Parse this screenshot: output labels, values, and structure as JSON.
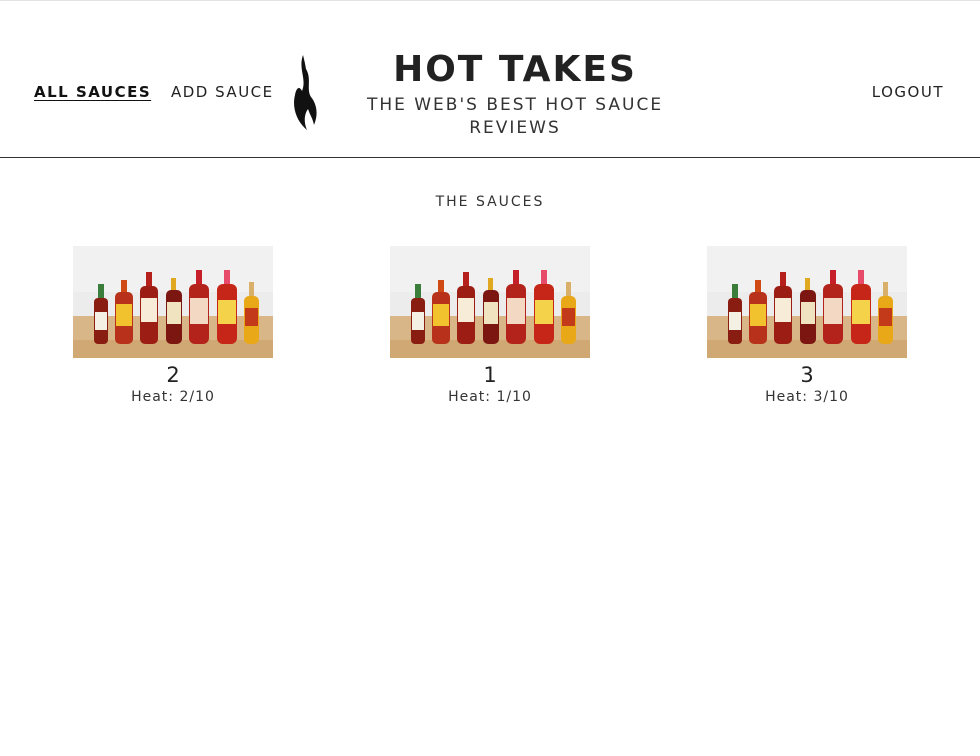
{
  "nav": {
    "all_sauces": "ALL SAUCES",
    "add_sauce": "ADD SAUCE",
    "logout": "LOGOUT"
  },
  "brand": {
    "title": "HOT TAKES",
    "subtitle_line1": "THE WEB'S BEST HOT SAUCE",
    "subtitle_line2": "REVIEWS"
  },
  "main": {
    "section_title": "THE SAUCES",
    "sauces": [
      {
        "name": "2",
        "heat": "Heat: 2/10"
      },
      {
        "name": "1",
        "heat": "Heat: 1/10"
      },
      {
        "name": "3",
        "heat": "Heat: 3/10"
      }
    ]
  },
  "icons": {
    "logo": "flame-icon",
    "sauce_image": "hot-sauce-bottles-image"
  },
  "colors": {
    "text": "#222222",
    "divider": "#333333",
    "background": "#ffffff"
  }
}
